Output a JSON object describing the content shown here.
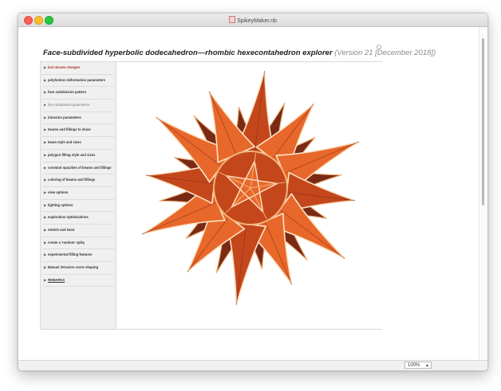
{
  "window": {
    "title": "SpikeyMaker.nb",
    "zoom": "100%"
  },
  "notebook": {
    "title": "Face-subdivided hyperbolic dodecahedron—rhombic hexecontahedron explorer",
    "version": "(Version 21 [December 2018])"
  },
  "sidebar": {
    "items": [
      {
        "label": "last minute changes"
      },
      {
        "label": "polyhedron deformation parameters"
      },
      {
        "label": "face subdivision pattern"
      },
      {
        "label": "face subdivision parameters"
      },
      {
        "label": "intrusion parameters"
      },
      {
        "label": "beams and fillings to show"
      },
      {
        "label": "beam style and sizes"
      },
      {
        "label": "polygon filling style and sizes"
      },
      {
        "label": "constant opacities of beams and fillings"
      },
      {
        "label": "coloring of beams and fillings"
      },
      {
        "label": "view options"
      },
      {
        "label": "lighting options"
      },
      {
        "label": "exploration optimizations"
      },
      {
        "label": "stretch and twist"
      },
      {
        "label": "create a 'random' spiky"
      },
      {
        "label": "experimental filling features"
      },
      {
        "label": "Manual intrusion curve shaping"
      },
      {
        "label": "REMARKS"
      }
    ]
  },
  "graphic": {
    "spike_count": 12,
    "colors": {
      "dark": "#7a2a14",
      "mid": "#c4471c",
      "bright": "#e8672a",
      "light": "#f0b47a",
      "edge": "#fbe3c4"
    }
  },
  "colors": {
    "accent_red": "#b4322b"
  }
}
